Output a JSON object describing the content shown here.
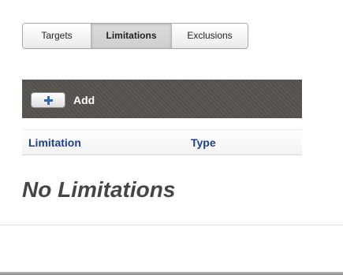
{
  "tabs": [
    {
      "label": "Targets",
      "active": false
    },
    {
      "label": "Limitations",
      "active": true
    },
    {
      "label": "Exclusions",
      "active": false
    }
  ],
  "toolbar": {
    "add_label": "Add",
    "add_icon": "plus-icon",
    "background_color": "#56524d",
    "icon_color": "#2f68b8"
  },
  "table": {
    "columns": [
      "Limitation",
      "Type"
    ],
    "header_color": "#1f3f8a"
  },
  "empty_state": {
    "message": "No Limitations"
  }
}
